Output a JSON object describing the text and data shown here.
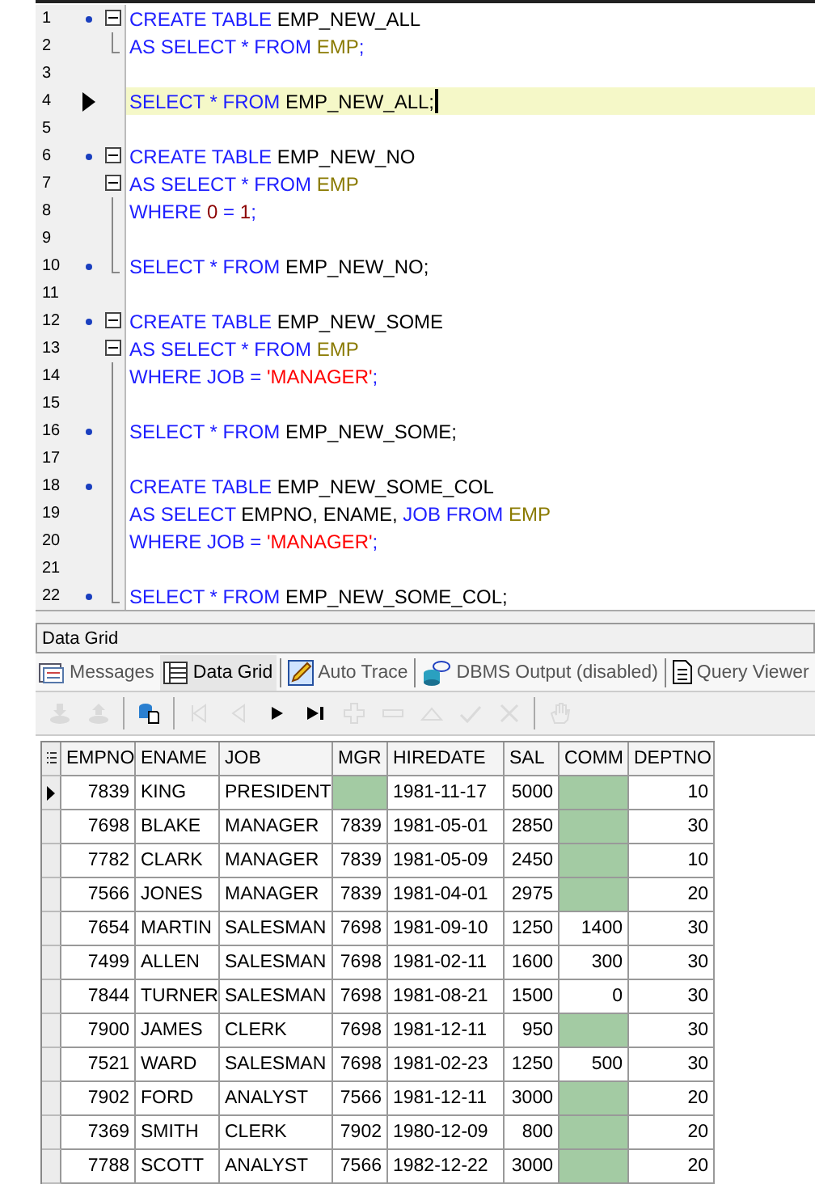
{
  "editor": {
    "lines": [
      {
        "number": "1",
        "marked": true,
        "collapsible": true,
        "in_fold": false,
        "fold_end": false,
        "current": false,
        "tokens": [
          {
            "text": "CREATE TABLE ",
            "kind": "keyword"
          },
          {
            "text": "EMP_NEW_ALL",
            "kind": "ident"
          }
        ]
      },
      {
        "number": "2",
        "marked": false,
        "collapsible": false,
        "in_fold": false,
        "fold_end": true,
        "current": false,
        "tokens": [
          {
            "text": "AS SELECT * FROM ",
            "kind": "keyword"
          },
          {
            "text": "EMP",
            "kind": "table"
          },
          {
            "text": ";",
            "kind": "keyword"
          }
        ]
      },
      {
        "number": "3",
        "marked": false,
        "collapsible": false,
        "in_fold": false,
        "fold_end": false,
        "current": false
      },
      {
        "number": "4",
        "marked": false,
        "collapsible": false,
        "in_fold": false,
        "fold_end": false,
        "current": true,
        "tokens": [
          {
            "text": "SELECT * FROM ",
            "kind": "keyword"
          },
          {
            "text": "EMP_NEW_ALL;",
            "kind": "ident"
          }
        ]
      },
      {
        "number": "5",
        "marked": false,
        "collapsible": false,
        "in_fold": false,
        "fold_end": false,
        "current": false
      },
      {
        "number": "6",
        "marked": true,
        "collapsible": true,
        "in_fold": false,
        "fold_end": false,
        "current": false,
        "tokens": [
          {
            "text": "CREATE TABLE ",
            "kind": "keyword"
          },
          {
            "text": "EMP_NEW_NO",
            "kind": "ident"
          }
        ]
      },
      {
        "number": "7",
        "marked": false,
        "collapsible": true,
        "in_fold": false,
        "fold_end": false,
        "current": false,
        "tokens": [
          {
            "text": "AS SELECT * FROM ",
            "kind": "keyword"
          },
          {
            "text": "EMP",
            "kind": "table"
          }
        ]
      },
      {
        "number": "8",
        "marked": false,
        "collapsible": false,
        "in_fold": true,
        "fold_end": false,
        "current": false,
        "tokens": [
          {
            "text": "WHERE ",
            "kind": "keyword"
          },
          {
            "text": "0",
            "kind": "number"
          },
          {
            "text": " = ",
            "kind": "keyword"
          },
          {
            "text": "1",
            "kind": "number"
          },
          {
            "text": ";",
            "kind": "keyword"
          }
        ]
      },
      {
        "number": "9",
        "marked": false,
        "collapsible": false,
        "in_fold": true,
        "fold_end": false,
        "current": false
      },
      {
        "number": "10",
        "marked": true,
        "collapsible": false,
        "in_fold": false,
        "fold_end": true,
        "current": false,
        "tokens": [
          {
            "text": "SELECT * FROM ",
            "kind": "keyword"
          },
          {
            "text": "EMP_NEW_NO;",
            "kind": "ident"
          }
        ]
      },
      {
        "number": "11",
        "marked": false,
        "collapsible": false,
        "in_fold": false,
        "fold_end": false,
        "current": false
      },
      {
        "number": "12",
        "marked": true,
        "collapsible": true,
        "in_fold": false,
        "fold_end": false,
        "current": false,
        "tokens": [
          {
            "text": "CREATE TABLE ",
            "kind": "keyword"
          },
          {
            "text": "EMP_NEW_SOME",
            "kind": "ident"
          }
        ]
      },
      {
        "number": "13",
        "marked": false,
        "collapsible": true,
        "in_fold": false,
        "fold_end": false,
        "current": false,
        "tokens": [
          {
            "text": "AS SELECT * FROM ",
            "kind": "keyword"
          },
          {
            "text": "EMP",
            "kind": "table"
          }
        ]
      },
      {
        "number": "14",
        "marked": false,
        "collapsible": false,
        "in_fold": true,
        "fold_end": false,
        "current": false,
        "tokens": [
          {
            "text": "WHERE JOB = ",
            "kind": "keyword"
          },
          {
            "text": "'MANAGER'",
            "kind": "string"
          },
          {
            "text": ";",
            "kind": "keyword"
          }
        ]
      },
      {
        "number": "15",
        "marked": false,
        "collapsible": false,
        "in_fold": true,
        "fold_end": false,
        "current": false
      },
      {
        "number": "16",
        "marked": true,
        "collapsible": false,
        "in_fold": true,
        "fold_end": false,
        "current": false,
        "tokens": [
          {
            "text": "SELECT * FROM ",
            "kind": "keyword"
          },
          {
            "text": "EMP_NEW_SOME;",
            "kind": "ident"
          }
        ]
      },
      {
        "number": "17",
        "marked": false,
        "collapsible": false,
        "in_fold": true,
        "fold_end": false,
        "current": false
      },
      {
        "number": "18",
        "marked": true,
        "collapsible": false,
        "in_fold": true,
        "fold_end": false,
        "current": false,
        "tokens": [
          {
            "text": "CREATE TABLE ",
            "kind": "keyword"
          },
          {
            "text": "EMP_NEW_SOME_COL",
            "kind": "ident"
          }
        ]
      },
      {
        "number": "19",
        "marked": false,
        "collapsible": false,
        "in_fold": true,
        "fold_end": false,
        "current": false,
        "tokens": [
          {
            "text": "AS SELECT ",
            "kind": "keyword"
          },
          {
            "text": "EMPNO, ENAME, ",
            "kind": "ident"
          },
          {
            "text": "JOB FROM ",
            "kind": "keyword"
          },
          {
            "text": "EMP",
            "kind": "table"
          }
        ]
      },
      {
        "number": "20",
        "marked": false,
        "collapsible": false,
        "in_fold": true,
        "fold_end": false,
        "current": false,
        "tokens": [
          {
            "text": "WHERE JOB = ",
            "kind": "keyword"
          },
          {
            "text": "'MANAGER'",
            "kind": "string"
          },
          {
            "text": ";",
            "kind": "keyword"
          }
        ]
      },
      {
        "number": "21",
        "marked": false,
        "collapsible": false,
        "in_fold": true,
        "fold_end": false,
        "current": false
      },
      {
        "number": "22",
        "marked": true,
        "collapsible": false,
        "in_fold": false,
        "fold_end": true,
        "current": false,
        "tokens": [
          {
            "text": "SELECT * FROM ",
            "kind": "keyword"
          },
          {
            "text": "EMP_NEW_SOME_COL;",
            "kind": "ident"
          }
        ]
      }
    ]
  },
  "panel": {
    "title": "Data Grid"
  },
  "tabs": [
    {
      "label": "Messages",
      "kind": "messages",
      "selected": false
    },
    {
      "label": "Data Grid",
      "kind": "grid",
      "selected": true
    },
    {
      "label": "Auto Trace",
      "kind": "trace",
      "selected": false
    },
    {
      "label": "DBMS Output (disabled)",
      "kind": "output",
      "selected": false
    },
    {
      "label": "Query Viewer",
      "kind": "viewer",
      "selected": false
    }
  ],
  "toolbar": [
    {
      "kind": "import",
      "disabled": true
    },
    {
      "kind": "export",
      "disabled": true
    },
    {
      "kind": "sep"
    },
    {
      "kind": "dbfile",
      "disabled": false
    },
    {
      "kind": "sep"
    },
    {
      "kind": "first",
      "disabled": true
    },
    {
      "kind": "prev",
      "disabled": true
    },
    {
      "kind": "next",
      "disabled": false
    },
    {
      "kind": "last",
      "disabled": false
    },
    {
      "kind": "insert",
      "disabled": true
    },
    {
      "kind": "delete",
      "disabled": true
    },
    {
      "kind": "edit",
      "disabled": true
    },
    {
      "kind": "post",
      "disabled": true
    },
    {
      "kind": "cancel",
      "disabled": true
    },
    {
      "kind": "sep"
    },
    {
      "kind": "hand",
      "disabled": true
    }
  ],
  "grid": {
    "columns": [
      {
        "label": "EMPNO",
        "numeric": true
      },
      {
        "label": "ENAME",
        "numeric": false
      },
      {
        "label": "JOB",
        "numeric": false
      },
      {
        "label": "MGR",
        "numeric": true
      },
      {
        "label": "HIREDATE",
        "numeric": false
      },
      {
        "label": "SAL",
        "numeric": true
      },
      {
        "label": "COMM",
        "numeric": true
      },
      {
        "label": "DEPTNO",
        "numeric": true
      }
    ],
    "rows": [
      {
        "selected": true,
        "cells": [
          "7839",
          "KING",
          "PRESIDENT",
          null,
          "1981-11-17",
          "5000",
          null,
          "10"
        ]
      },
      {
        "selected": false,
        "cells": [
          "7698",
          "BLAKE",
          "MANAGER",
          "7839",
          "1981-05-01",
          "2850",
          null,
          "30"
        ]
      },
      {
        "selected": false,
        "cells": [
          "7782",
          "CLARK",
          "MANAGER",
          "7839",
          "1981-05-09",
          "2450",
          null,
          "10"
        ]
      },
      {
        "selected": false,
        "cells": [
          "7566",
          "JONES",
          "MANAGER",
          "7839",
          "1981-04-01",
          "2975",
          null,
          "20"
        ]
      },
      {
        "selected": false,
        "cells": [
          "7654",
          "MARTIN",
          "SALESMAN",
          "7698",
          "1981-09-10",
          "1250",
          "1400",
          "30"
        ]
      },
      {
        "selected": false,
        "cells": [
          "7499",
          "ALLEN",
          "SALESMAN",
          "7698",
          "1981-02-11",
          "1600",
          "300",
          "30"
        ]
      },
      {
        "selected": false,
        "cells": [
          "7844",
          "TURNER",
          "SALESMAN",
          "7698",
          "1981-08-21",
          "1500",
          "0",
          "30"
        ]
      },
      {
        "selected": false,
        "cells": [
          "7900",
          "JAMES",
          "CLERK",
          "7698",
          "1981-12-11",
          "950",
          null,
          "30"
        ]
      },
      {
        "selected": false,
        "cells": [
          "7521",
          "WARD",
          "SALESMAN",
          "7698",
          "1981-02-23",
          "1250",
          "500",
          "30"
        ]
      },
      {
        "selected": false,
        "cells": [
          "7902",
          "FORD",
          "ANALYST",
          "7566",
          "1981-12-11",
          "3000",
          null,
          "20"
        ]
      },
      {
        "selected": false,
        "cells": [
          "7369",
          "SMITH",
          "CLERK",
          "7902",
          "1980-12-09",
          "800",
          null,
          "20"
        ]
      },
      {
        "selected": false,
        "cells": [
          "7788",
          "SCOTT",
          "ANALYST",
          "7566",
          "1982-12-22",
          "3000",
          null,
          "20"
        ]
      }
    ]
  }
}
